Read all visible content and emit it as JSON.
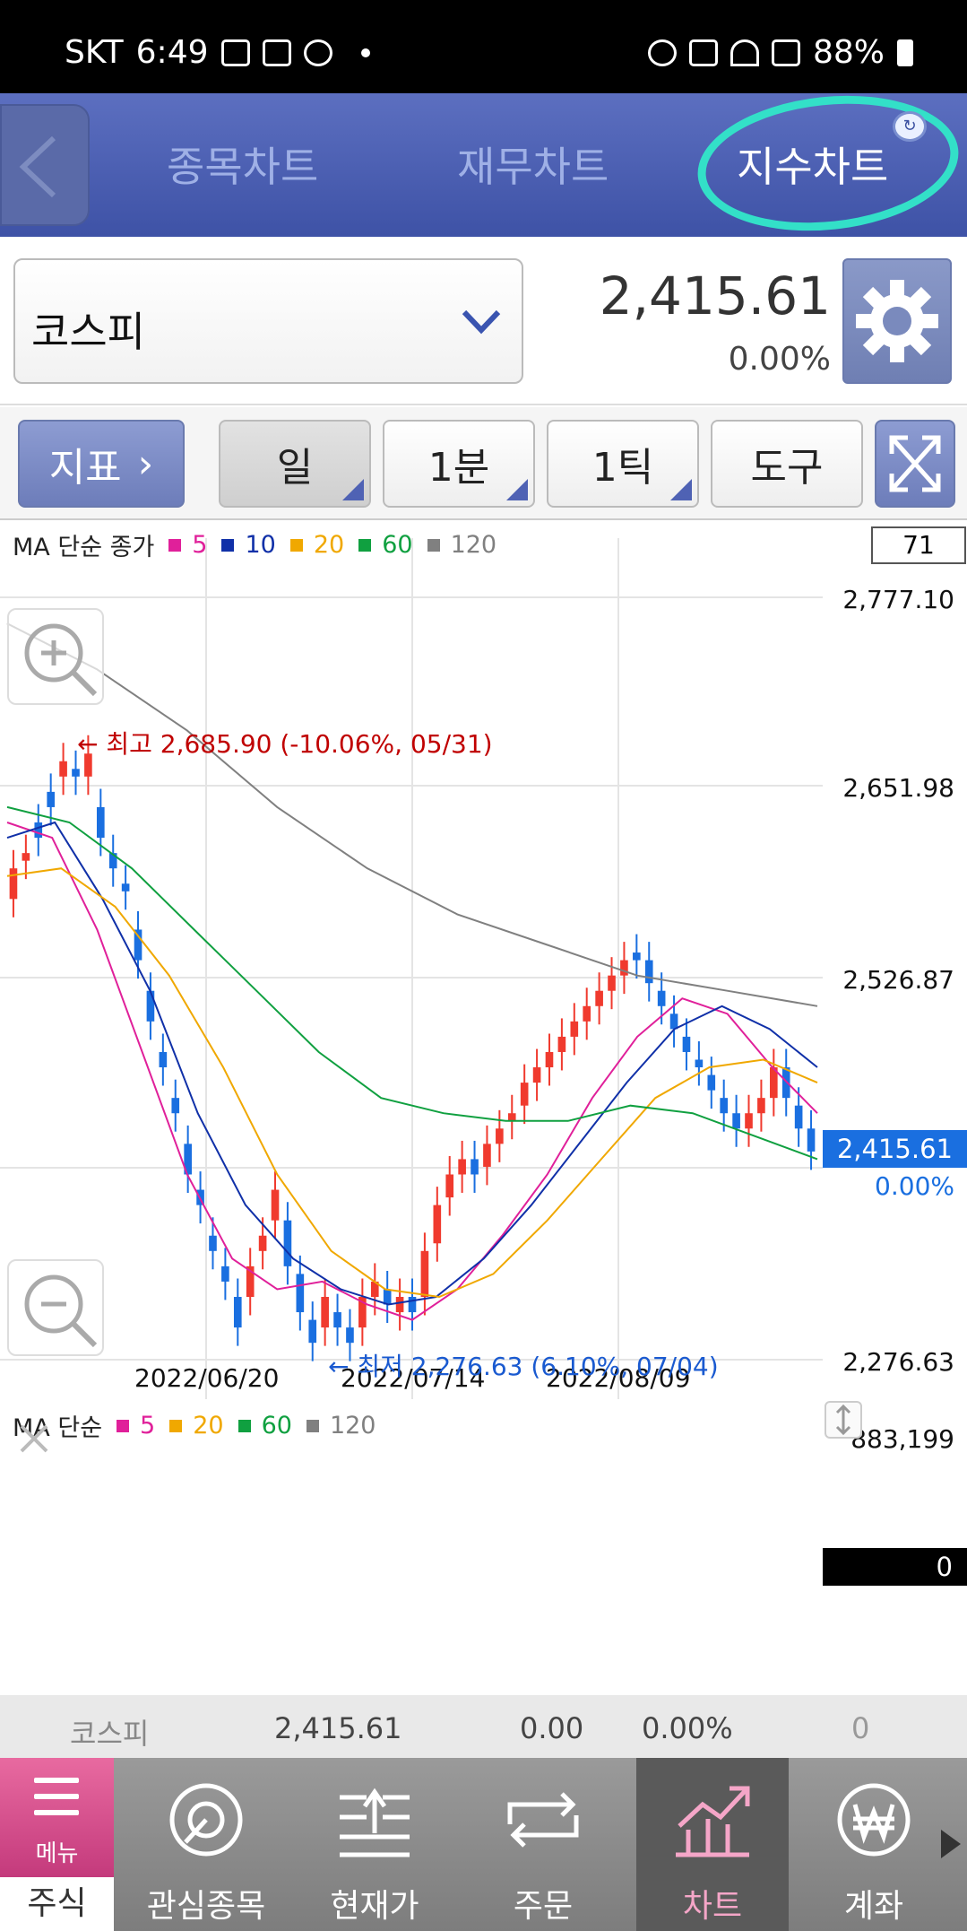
{
  "status": {
    "carrier": "SKT",
    "time": "6:49",
    "battery": "88%"
  },
  "tabs": [
    {
      "label": "종목차트"
    },
    {
      "label": "재무차트"
    },
    {
      "label": "지수차트"
    }
  ],
  "active_tab": "지수차트",
  "selector": {
    "stock": "코스피",
    "price": "2,415.61",
    "change_pct": "0.00%"
  },
  "toolbar": {
    "indicator": "지표",
    "day": "일",
    "minute": "1분",
    "tick": "1틱",
    "tools": "도구"
  },
  "chart": {
    "legend": {
      "title": "MA 단순 종가",
      "items": [
        {
          "label": "5",
          "color": "#e0209a"
        },
        {
          "label": "10",
          "color": "#1030a8"
        },
        {
          "label": "20",
          "color": "#f0a800"
        },
        {
          "label": "60",
          "color": "#10a040"
        },
        {
          "label": "120",
          "color": "#808080"
        }
      ]
    },
    "count": "71",
    "y_labels": [
      "2,777.10",
      "2,651.98",
      "2,526.87",
      "2,276.63"
    ],
    "current_price": "2,415.61",
    "current_pct": "0.00%",
    "x_labels": [
      "2022/06/20",
      "2022/07/14",
      "2022/08/09"
    ],
    "high_note": "← 최고 2,685.90 (-10.06%, 05/31)",
    "low_note": "← 최저 2,276.63 (6.10%, 07/04)"
  },
  "volume": {
    "legend": {
      "title": "MA 단순",
      "items": [
        {
          "label": "5",
          "color": "#e0209a"
        },
        {
          "label": "20",
          "color": "#f0a800"
        },
        {
          "label": "60",
          "color": "#10a040"
        },
        {
          "label": "120",
          "color": "#808080"
        }
      ]
    },
    "max_label": "883,199",
    "current_label": "0"
  },
  "summary": {
    "name": "코스피",
    "price": "2,415.61",
    "change": "0.00",
    "pct": "0.00%",
    "volume": "0"
  },
  "nav": {
    "menu": "메뉴",
    "market": "주식",
    "items": [
      {
        "label": "관심종목"
      },
      {
        "label": "현재가"
      },
      {
        "label": "주문"
      },
      {
        "label": "차트"
      },
      {
        "label": "계좌"
      }
    ]
  },
  "colors": {
    "up": "#f03a2e",
    "down": "#1a6fe0",
    "accent": "#4f62b4",
    "highlight": "#33e0c8"
  },
  "chart_data": {
    "type": "candlestick",
    "title": "",
    "ylim": [
      2276.63,
      2777.1
    ],
    "x_ticks": [
      "2022/06/20",
      "2022/07/14",
      "2022/08/09"
    ],
    "high": {
      "value": 2685.9,
      "date": "05/31",
      "pct": -10.06
    },
    "low": {
      "value": 2276.63,
      "date": "07/04",
      "pct": 6.1
    },
    "last": 2415.61,
    "closes": [
      2600,
      2610,
      2620,
      2640,
      2670,
      2660,
      2675,
      2620,
      2600,
      2585,
      2540,
      2500,
      2470,
      2440,
      2400,
      2380,
      2350,
      2330,
      2300,
      2340,
      2360,
      2390,
      2340,
      2310,
      2290,
      2320,
      2300,
      2290,
      2320,
      2330,
      2315,
      2320,
      2310,
      2350,
      2380,
      2400,
      2410,
      2400,
      2420,
      2430,
      2440,
      2460,
      2470,
      2480,
      2490,
      2500,
      2510,
      2520,
      2530,
      2540,
      2540,
      2525,
      2510,
      2495,
      2480,
      2470,
      2455,
      2440,
      2430,
      2440,
      2450,
      2470,
      2450,
      2430,
      2415
    ],
    "opens": [
      2580,
      2605,
      2630,
      2650,
      2660,
      2665,
      2660,
      2640,
      2610,
      2590,
      2560,
      2520,
      2480,
      2450,
      2420,
      2390,
      2360,
      2340,
      2320,
      2320,
      2350,
      2370,
      2370,
      2335,
      2305,
      2300,
      2310,
      2300,
      2300,
      2320,
      2325,
      2310,
      2320,
      2320,
      2355,
      2385,
      2400,
      2410,
      2405,
      2420,
      2435,
      2445,
      2460,
      2470,
      2480,
      2490,
      2500,
      2510,
      2520,
      2530,
      2545,
      2540,
      2520,
      2505,
      2490,
      2475,
      2465,
      2450,
      2440,
      2430,
      2440,
      2450,
      2470,
      2445,
      2430
    ],
    "ma": [
      {
        "name": "5",
        "values": [
          2630,
          2620,
          2560,
          2480,
          2400,
          2345,
          2325,
          2330,
          2315,
          2305,
          2325,
          2360,
          2400,
          2450,
          2490,
          2515,
          2505,
          2470,
          2440
        ]
      },
      {
        "name": "10",
        "values": [
          2620,
          2630,
          2580,
          2520,
          2440,
          2380,
          2345,
          2325,
          2315,
          2320,
          2345,
          2380,
          2420,
          2460,
          2495,
          2510,
          2495,
          2470
        ]
      },
      {
        "name": "20",
        "values": [
          2595,
          2600,
          2575,
          2530,
          2470,
          2400,
          2350,
          2325,
          2320,
          2335,
          2370,
          2410,
          2450,
          2470,
          2475,
          2460
        ]
      },
      {
        "name": "60",
        "values": [
          2640,
          2630,
          2600,
          2560,
          2520,
          2480,
          2450,
          2440,
          2435,
          2435,
          2445,
          2440,
          2425,
          2410
        ]
      },
      {
        "name": "120",
        "values": [
          2760,
          2730,
          2690,
          2640,
          2600,
          2570,
          2550,
          2530,
          2520,
          2510
        ]
      }
    ]
  }
}
